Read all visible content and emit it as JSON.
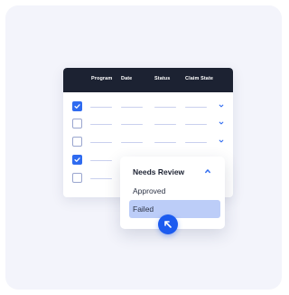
{
  "table": {
    "columns": [
      "Program",
      "Date",
      "Status",
      "Claim State"
    ],
    "rows": [
      {
        "checked": true,
        "has_dropdown": true
      },
      {
        "checked": false,
        "has_dropdown": true
      },
      {
        "checked": false,
        "has_dropdown": true
      },
      {
        "checked": true,
        "has_dropdown": false
      },
      {
        "checked": false,
        "has_dropdown": false
      }
    ]
  },
  "dropdown": {
    "header": "Needs Review",
    "options": [
      "Approved",
      "Failed"
    ],
    "selected": "Failed"
  },
  "icons": {
    "checkbox_check": "check-icon",
    "row_expand": "chevron-down-icon",
    "dropdown_collapse": "chevron-up-icon",
    "cursor": "cursor-arrow-icon"
  },
  "colors": {
    "header_bg": "#1c2232",
    "accent": "#2f6bf0",
    "selected_option_bg": "#bccdf8",
    "card_bg": "#f3f4fb"
  }
}
